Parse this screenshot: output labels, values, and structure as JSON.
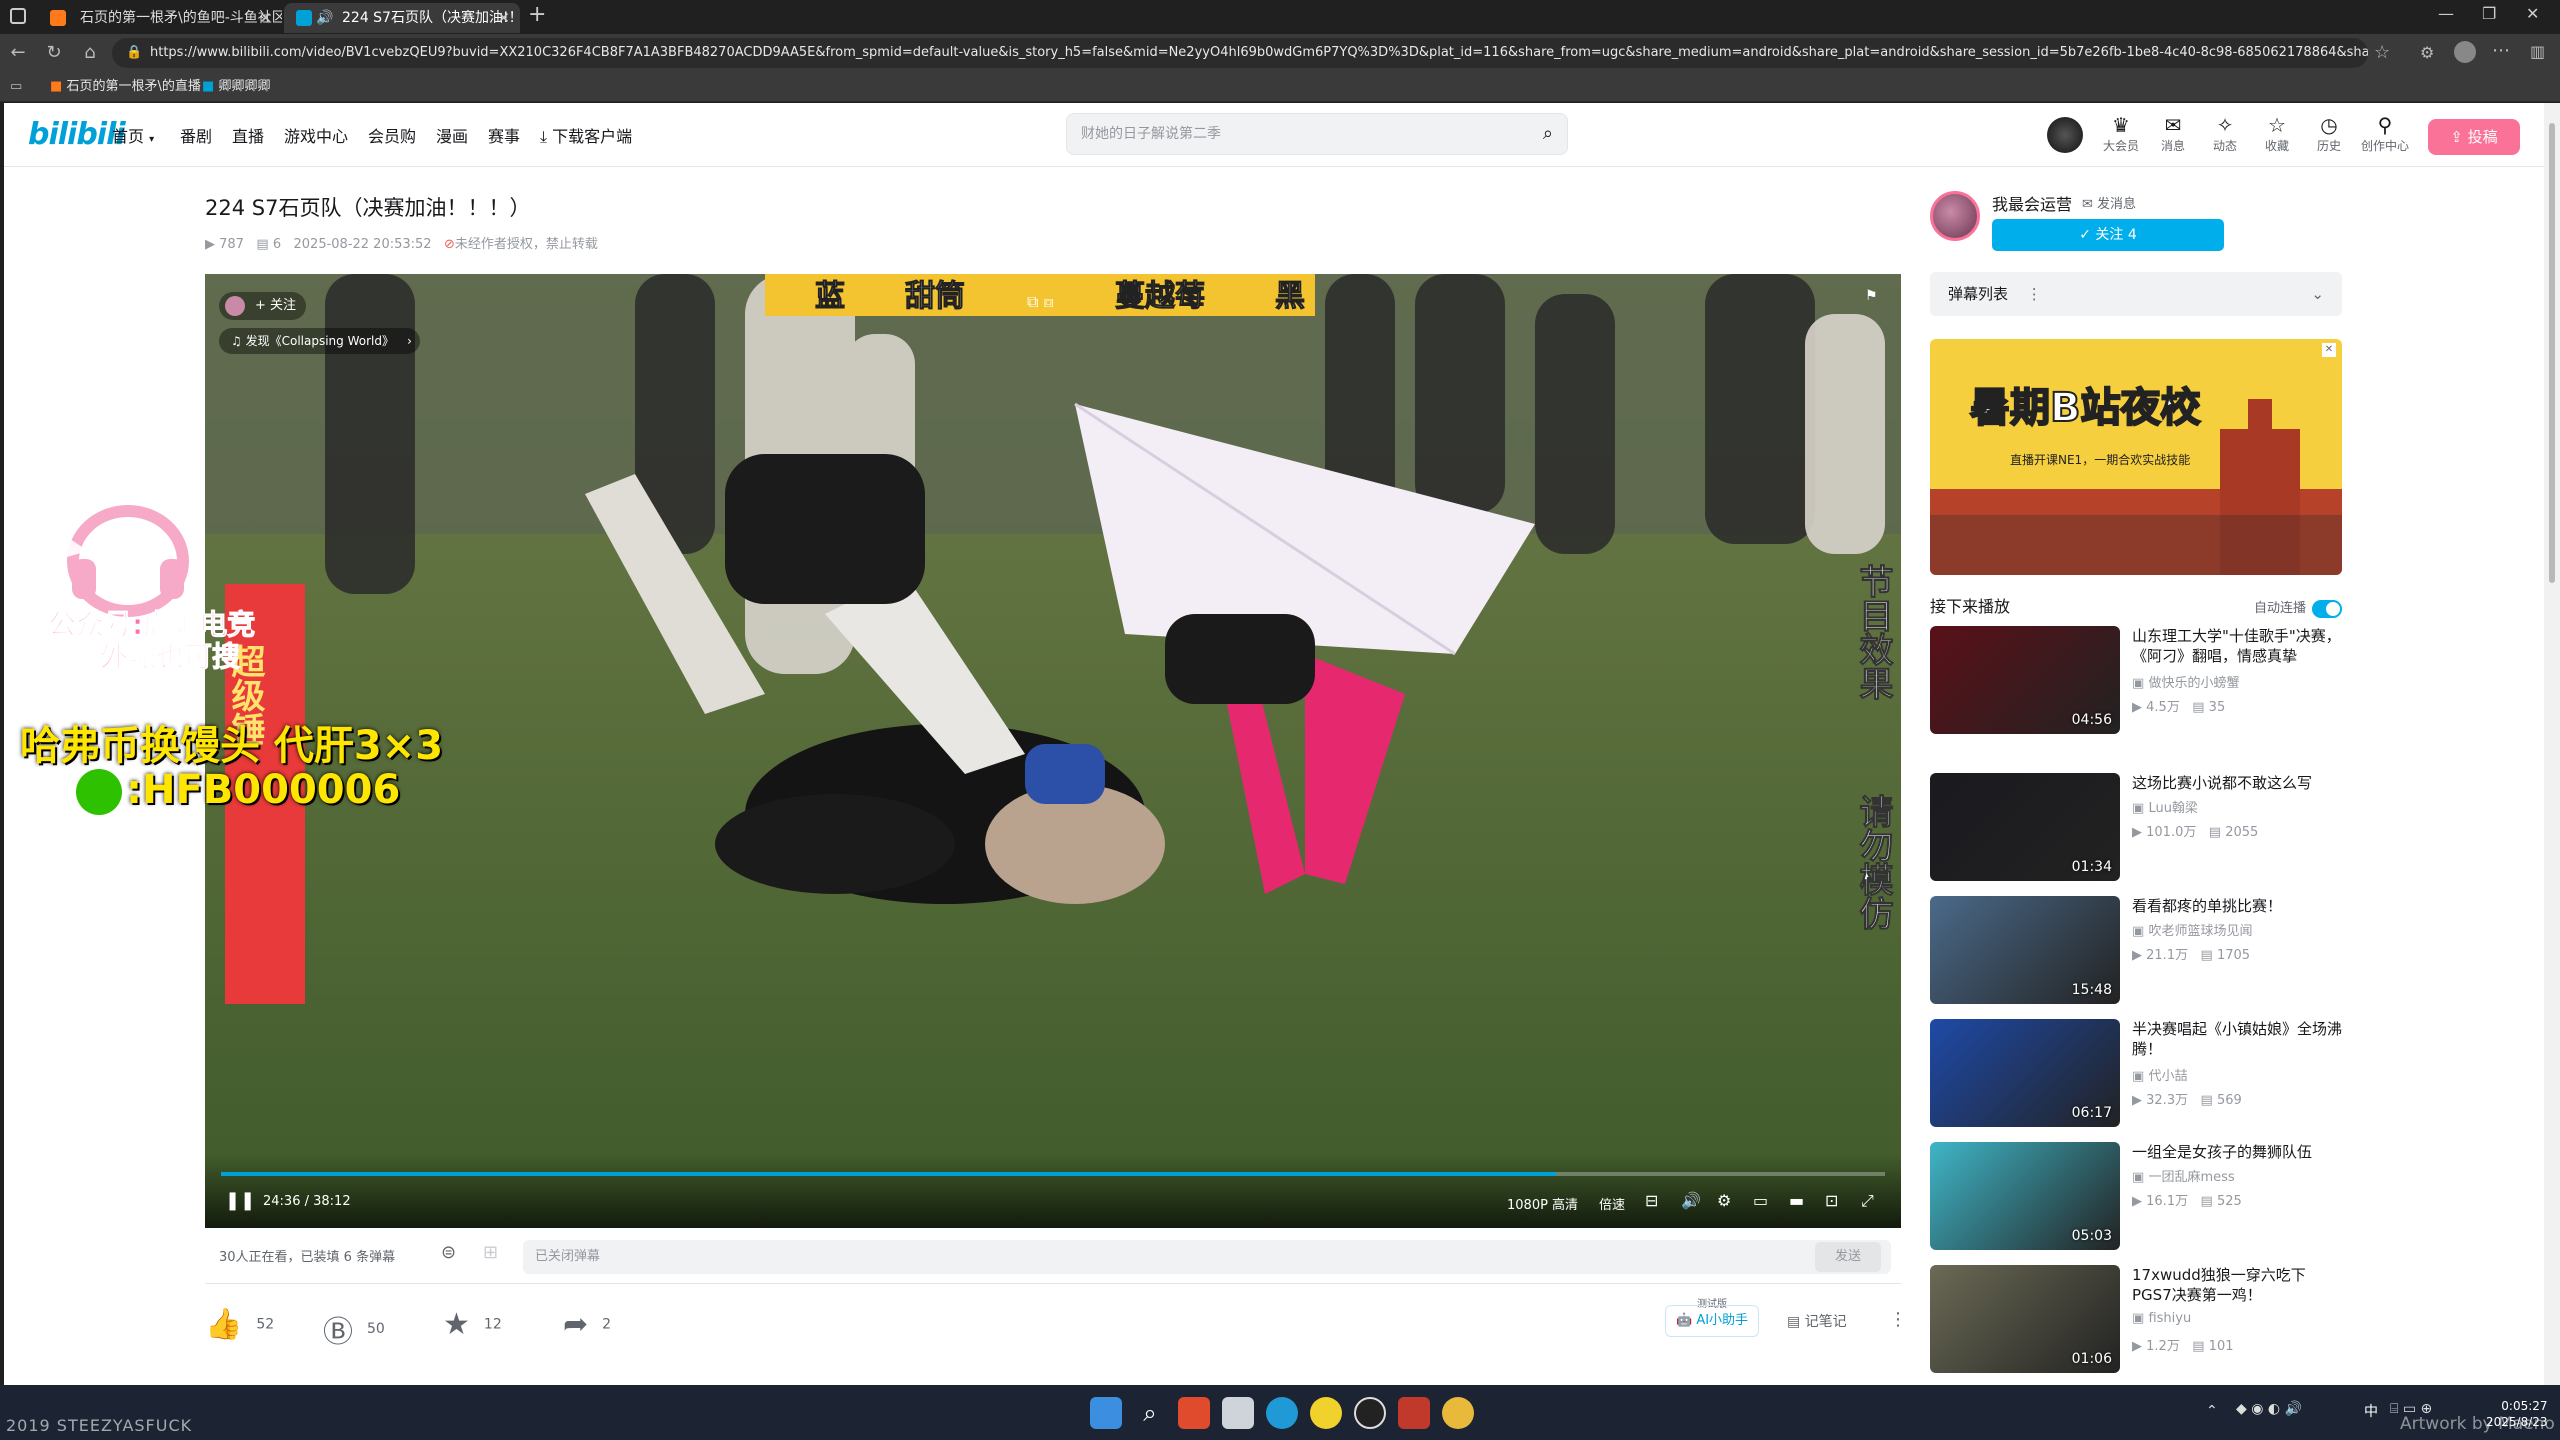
{
  "browser": {
    "tabs": [
      {
        "title": "石页的第一根矛\\的鱼吧-斗鱼社区",
        "active": false
      },
      {
        "title": "224 S7石页队（决赛加油!！",
        "active": true
      }
    ],
    "url": "https://www.bilibili.com/video/BV1cvebzQEU9?buvid=XX210C326F4CB8F7A1A3BFB48270ACDD9AA5E&from_spmid=default-value&is_story_h5=false&mid=Ne2yyO4hl69b0wdGm6P7YQ%3D%3D&plat_id=116&share_from=ugc&share_medium=android&share_plat=android&share_session_id=5b7e26fb-1be8-4c40-8c98-685062178864&share_source=COPY...",
    "bookmarks": [
      "石页的第一根矛\\的直播",
      "卿卿卿卿"
    ]
  },
  "header": {
    "logo": "bilibili",
    "nav": [
      "首页",
      "番剧",
      "直播",
      "游戏中心",
      "会员购",
      "漫画",
      "赛事",
      "下载客户端"
    ],
    "search_placeholder": "财她的日子解说第二季",
    "icons": [
      {
        "label": "大会员",
        "icon": "vip-icon"
      },
      {
        "label": "消息",
        "icon": "message-icon"
      },
      {
        "label": "动态",
        "icon": "dynamic-icon"
      },
      {
        "label": "收藏",
        "icon": "favorite-icon"
      },
      {
        "label": "历史",
        "icon": "history-icon"
      },
      {
        "label": "创作中心",
        "icon": "creator-icon"
      }
    ],
    "upload_label": "投稿"
  },
  "video": {
    "title": "224 S7石页队（决赛加油！！！）",
    "views": "787",
    "danmaku_count": "6",
    "datetime": "2025-08-22 20:53:52",
    "copyright": "未经作者授权，禁止转载",
    "overlay_follow": "+ 关注",
    "overlay_music": "发现《Collapsing World》",
    "banner_words": [
      "蓝",
      "甜筒",
      "蔓越莓",
      "黑"
    ],
    "side_caption_1": "节目效果",
    "side_caption_2": "请勿模仿",
    "left_caption": "超级锤",
    "watermark_1": "公众号:虐姬电竞",
    "watermark_2": "外呢也可搜",
    "ad_line_1": "哈弗币换馒头 代肝3×3",
    "ad_line_2": ":HFB000006",
    "time_current": "24:36",
    "time_total": "38:12",
    "progress": 0.802,
    "quality": "1080P 高清",
    "speed": "倍速"
  },
  "danmaku_bar": {
    "watching": "30人正在看，已装填 6 条弹幕",
    "input_placeholder": "已关闭弹幕",
    "send": "发送"
  },
  "toolbar": {
    "like": "52",
    "coin": "50",
    "fav": "12",
    "share": "2",
    "ai_badge": "测试版",
    "ai": "AI小助手",
    "notes": "记笔记"
  },
  "uploader": {
    "name": "我最会运营",
    "message": "发消息",
    "follow": "关注 4"
  },
  "sidebar": {
    "danmaku_list": "弹幕列表",
    "banner_text": "暑期B站夜校",
    "banner_sub": "直播开课NE1，一期合欢实战技能",
    "next_up": "接下来播放",
    "autoplay": "自动连播"
  },
  "recommendations": [
    {
      "title": "山东理工大学\"十佳歌手\"决赛，《阿刁》翻唱，情感真挚",
      "author": "做快乐的小螃蟹",
      "views": "4.5万",
      "danmaku": "35",
      "duration": "04:56",
      "thumb": "#5a1018"
    },
    {
      "title": "这场比赛小说都不敢这么写",
      "author": "Luu翰梁",
      "views": "101.0万",
      "danmaku": "2055",
      "duration": "01:34",
      "thumb": "#1a1a1f"
    },
    {
      "title": "看看都疼的单挑比赛！",
      "author": "吹老师篮球场见闻",
      "views": "21.1万",
      "danmaku": "1705",
      "duration": "15:48",
      "thumb": "#4b6a8a"
    },
    {
      "title": "半决赛唱起《小镇姑娘》全场沸腾！",
      "author": "代小喆",
      "views": "32.3万",
      "danmaku": "569",
      "duration": "06:17",
      "thumb": "#1e4aa8"
    },
    {
      "title": "一组全是女孩子的舞狮队伍",
      "author": "一团乱麻mess",
      "views": "16.1万",
      "danmaku": "525",
      "duration": "05:03",
      "thumb": "#3fb6c8"
    },
    {
      "title": "17xwudd独狼一穿六吃下PGS7决赛第一鸡！",
      "author": "fishiyu",
      "views": "1.2万",
      "danmaku": "101",
      "duration": "01:06",
      "thumb": "#6b6a55"
    }
  ],
  "taskbar": {
    "watermark_left": "2019 STEEZYASFUCK",
    "watermark_right": "Artwork by Maeno",
    "time": "0:05:27",
    "date": "2025/8/23",
    "ime": "中"
  }
}
